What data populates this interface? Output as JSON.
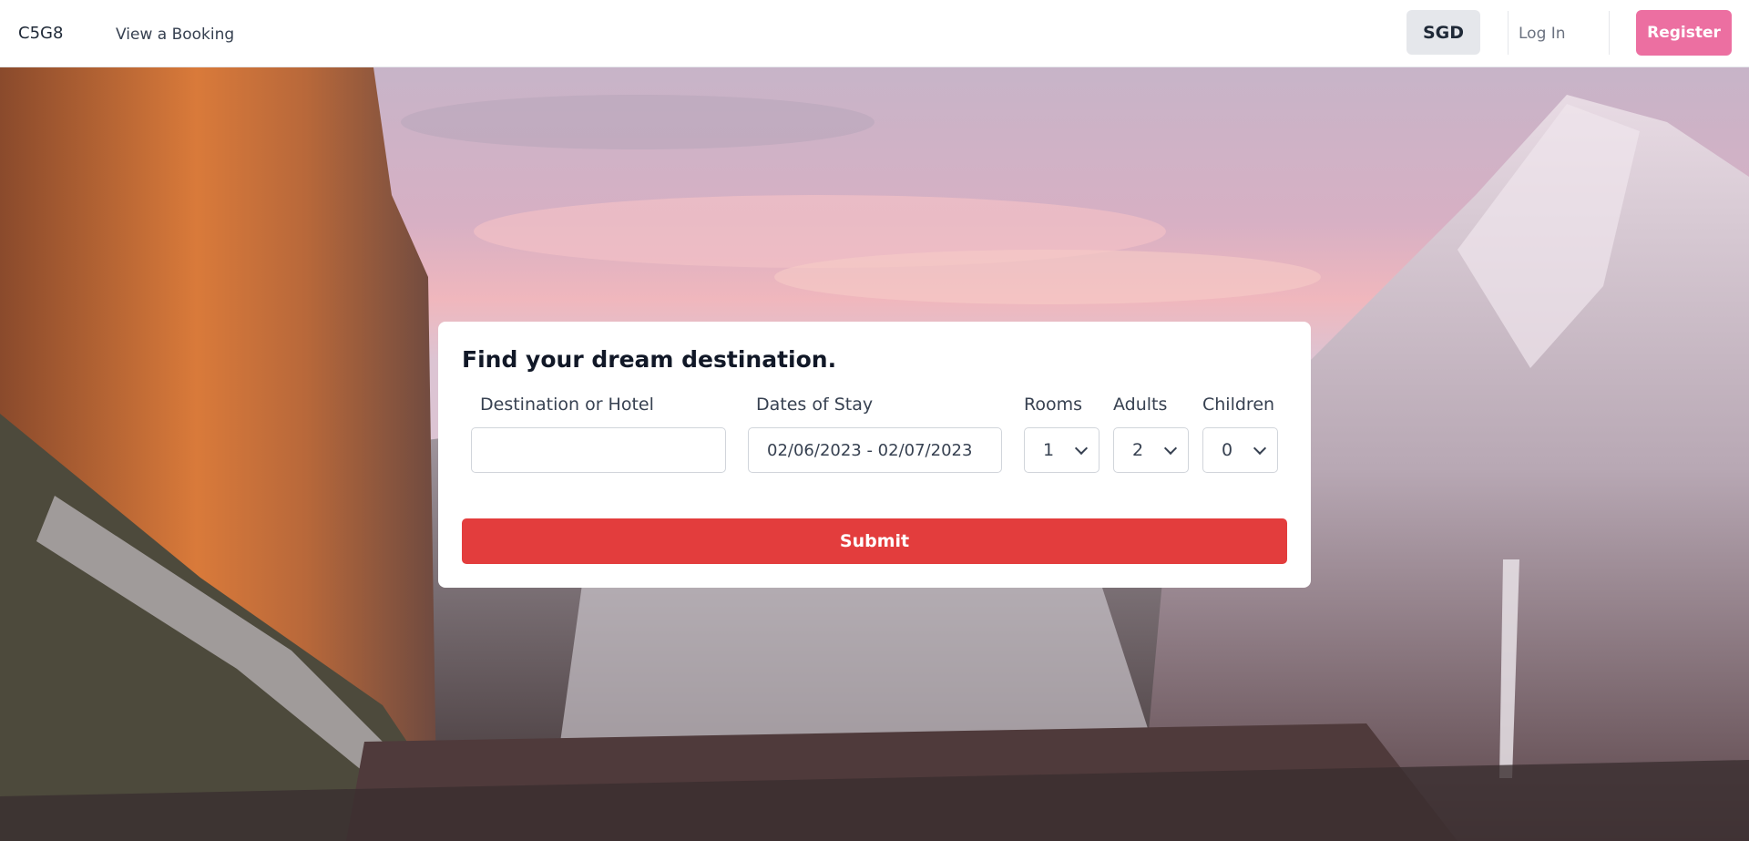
{
  "nav": {
    "brand": "C5G8",
    "view_booking": "View a Booking",
    "currency": "SGD",
    "login": "Log In",
    "register": "Register"
  },
  "search": {
    "title": "Find your dream destination.",
    "destination_label": "Destination or Hotel",
    "destination_value": "",
    "dates_label": "Dates of Stay",
    "dates_value": "02/06/2023 - 02/07/2023",
    "rooms_label": "Rooms",
    "rooms_value": "1",
    "adults_label": "Adults",
    "adults_value": "2",
    "children_label": "Children",
    "children_value": "0",
    "submit_label": "Submit"
  },
  "colors": {
    "register_bg": "#ec6fa1",
    "submit_bg": "#e33d3d",
    "currency_bg": "#e5e7eb"
  },
  "icons": {
    "select_chevron": "chevron-down-icon"
  }
}
